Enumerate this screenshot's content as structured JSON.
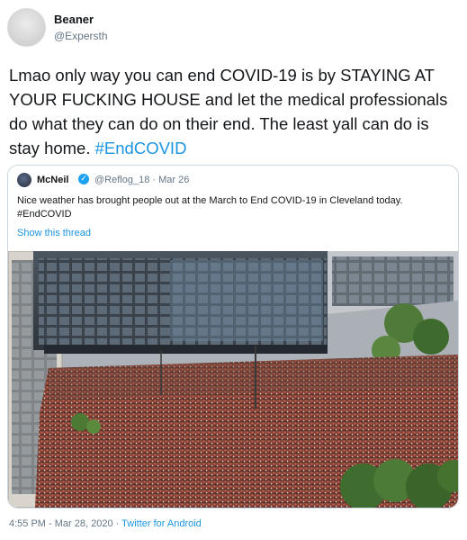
{
  "author": {
    "display_name": "Beaner",
    "handle": "@Expersth"
  },
  "tweet": {
    "text": "Lmao only way you can end COVID-19 is by STAYING AT YOUR FUCKING HOUSE and let the medical professionals do what they can do on their end. The least yall can do is stay home. ",
    "hashtag": "#EndCOVID"
  },
  "quoted_tweet": {
    "display_name": "McNeil",
    "verified_icon": "verified-badge-icon",
    "meta": "@Reflog_18 · Mar 26",
    "text": "Nice weather has brought people out at the March to End COVID-19 in Cleveland today. #EndCOVID",
    "thread_link": "Show this thread",
    "media": "crowd-photo"
  },
  "footer": {
    "timestamp": "4:55 PM - Mar 28, 2020 · ",
    "source": "Twitter for Android"
  },
  "colors": {
    "link": "#1b95e0",
    "muted": "#657786",
    "text": "#14171a",
    "border": "#ccd6dd"
  }
}
